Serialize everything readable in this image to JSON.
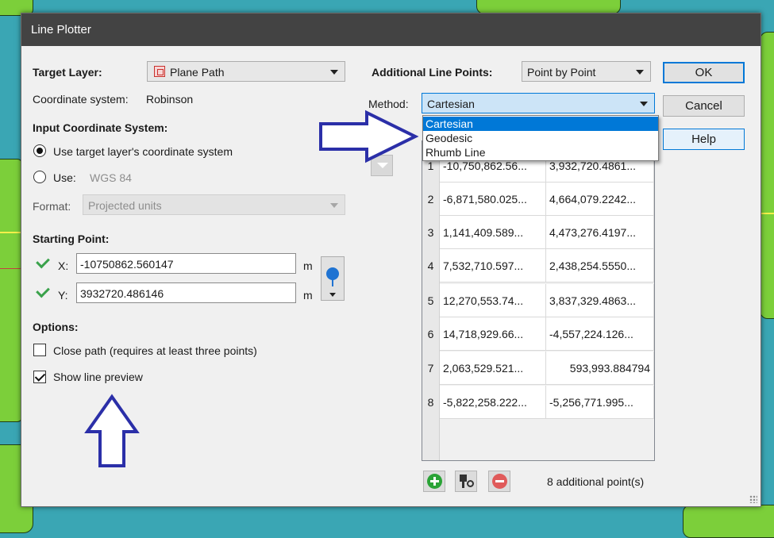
{
  "dialog": {
    "title": "Line Plotter"
  },
  "target_layer": {
    "label": "Target Layer:",
    "value": "Plane Path",
    "coord_system_label": "Coordinate system:",
    "coord_system_value": "Robinson"
  },
  "input_cs": {
    "heading": "Input Coordinate System:",
    "option_target": "Use target layer's coordinate system",
    "option_use": "Use:",
    "use_value": "WGS 84",
    "format_label": "Format:",
    "format_value": "Projected units"
  },
  "starting_point": {
    "heading": "Starting Point:",
    "x_label": "X:",
    "x_value": "-10750862.560147",
    "x_unit": "m",
    "y_label": "Y:",
    "y_value": "3932720.486146",
    "y_unit": "m"
  },
  "options": {
    "heading": "Options:",
    "close_path": "Close path (requires at least three points)",
    "close_path_checked": false,
    "show_preview": "Show line preview",
    "show_preview_checked": true
  },
  "additional_points": {
    "label": "Additional Line Points:",
    "mode_value": "Point by Point",
    "method_label": "Method:",
    "method_value": "Cartesian",
    "method_options": [
      "Cartesian",
      "Geodesic",
      "Rhumb Line"
    ],
    "selected_option": "Cartesian",
    "rows": [
      {
        "n": "1",
        "x": "-10,750,862.56...",
        "y": "3,932,720.4861..."
      },
      {
        "n": "2",
        "x": "-6,871,580.025...",
        "y": "4,664,079.2242..."
      },
      {
        "n": "3",
        "x": "1,141,409.589...",
        "y": "4,473,276.4197..."
      },
      {
        "n": "4",
        "x": "7,532,710.597...",
        "y": "2,438,254.5550..."
      },
      {
        "n": "5",
        "x": "12,270,553.74...",
        "y": "3,837,329.4863..."
      },
      {
        "n": "6",
        "x": "14,718,929.66...",
        "y": "-4,557,224.126..."
      },
      {
        "n": "7",
        "x": "2,063,529.521...",
        "y": "593,993.884794"
      },
      {
        "n": "8",
        "x": "-5,822,258.222...",
        "y": "-5,256,771.995..."
      }
    ],
    "count_text": "8 additional point(s)"
  },
  "buttons": {
    "ok": "OK",
    "cancel": "Cancel",
    "help": "Help"
  },
  "colors": {
    "titlebar": "#434343",
    "annotation_arrow": "#2b2fa8",
    "accent": "#0078d7"
  }
}
